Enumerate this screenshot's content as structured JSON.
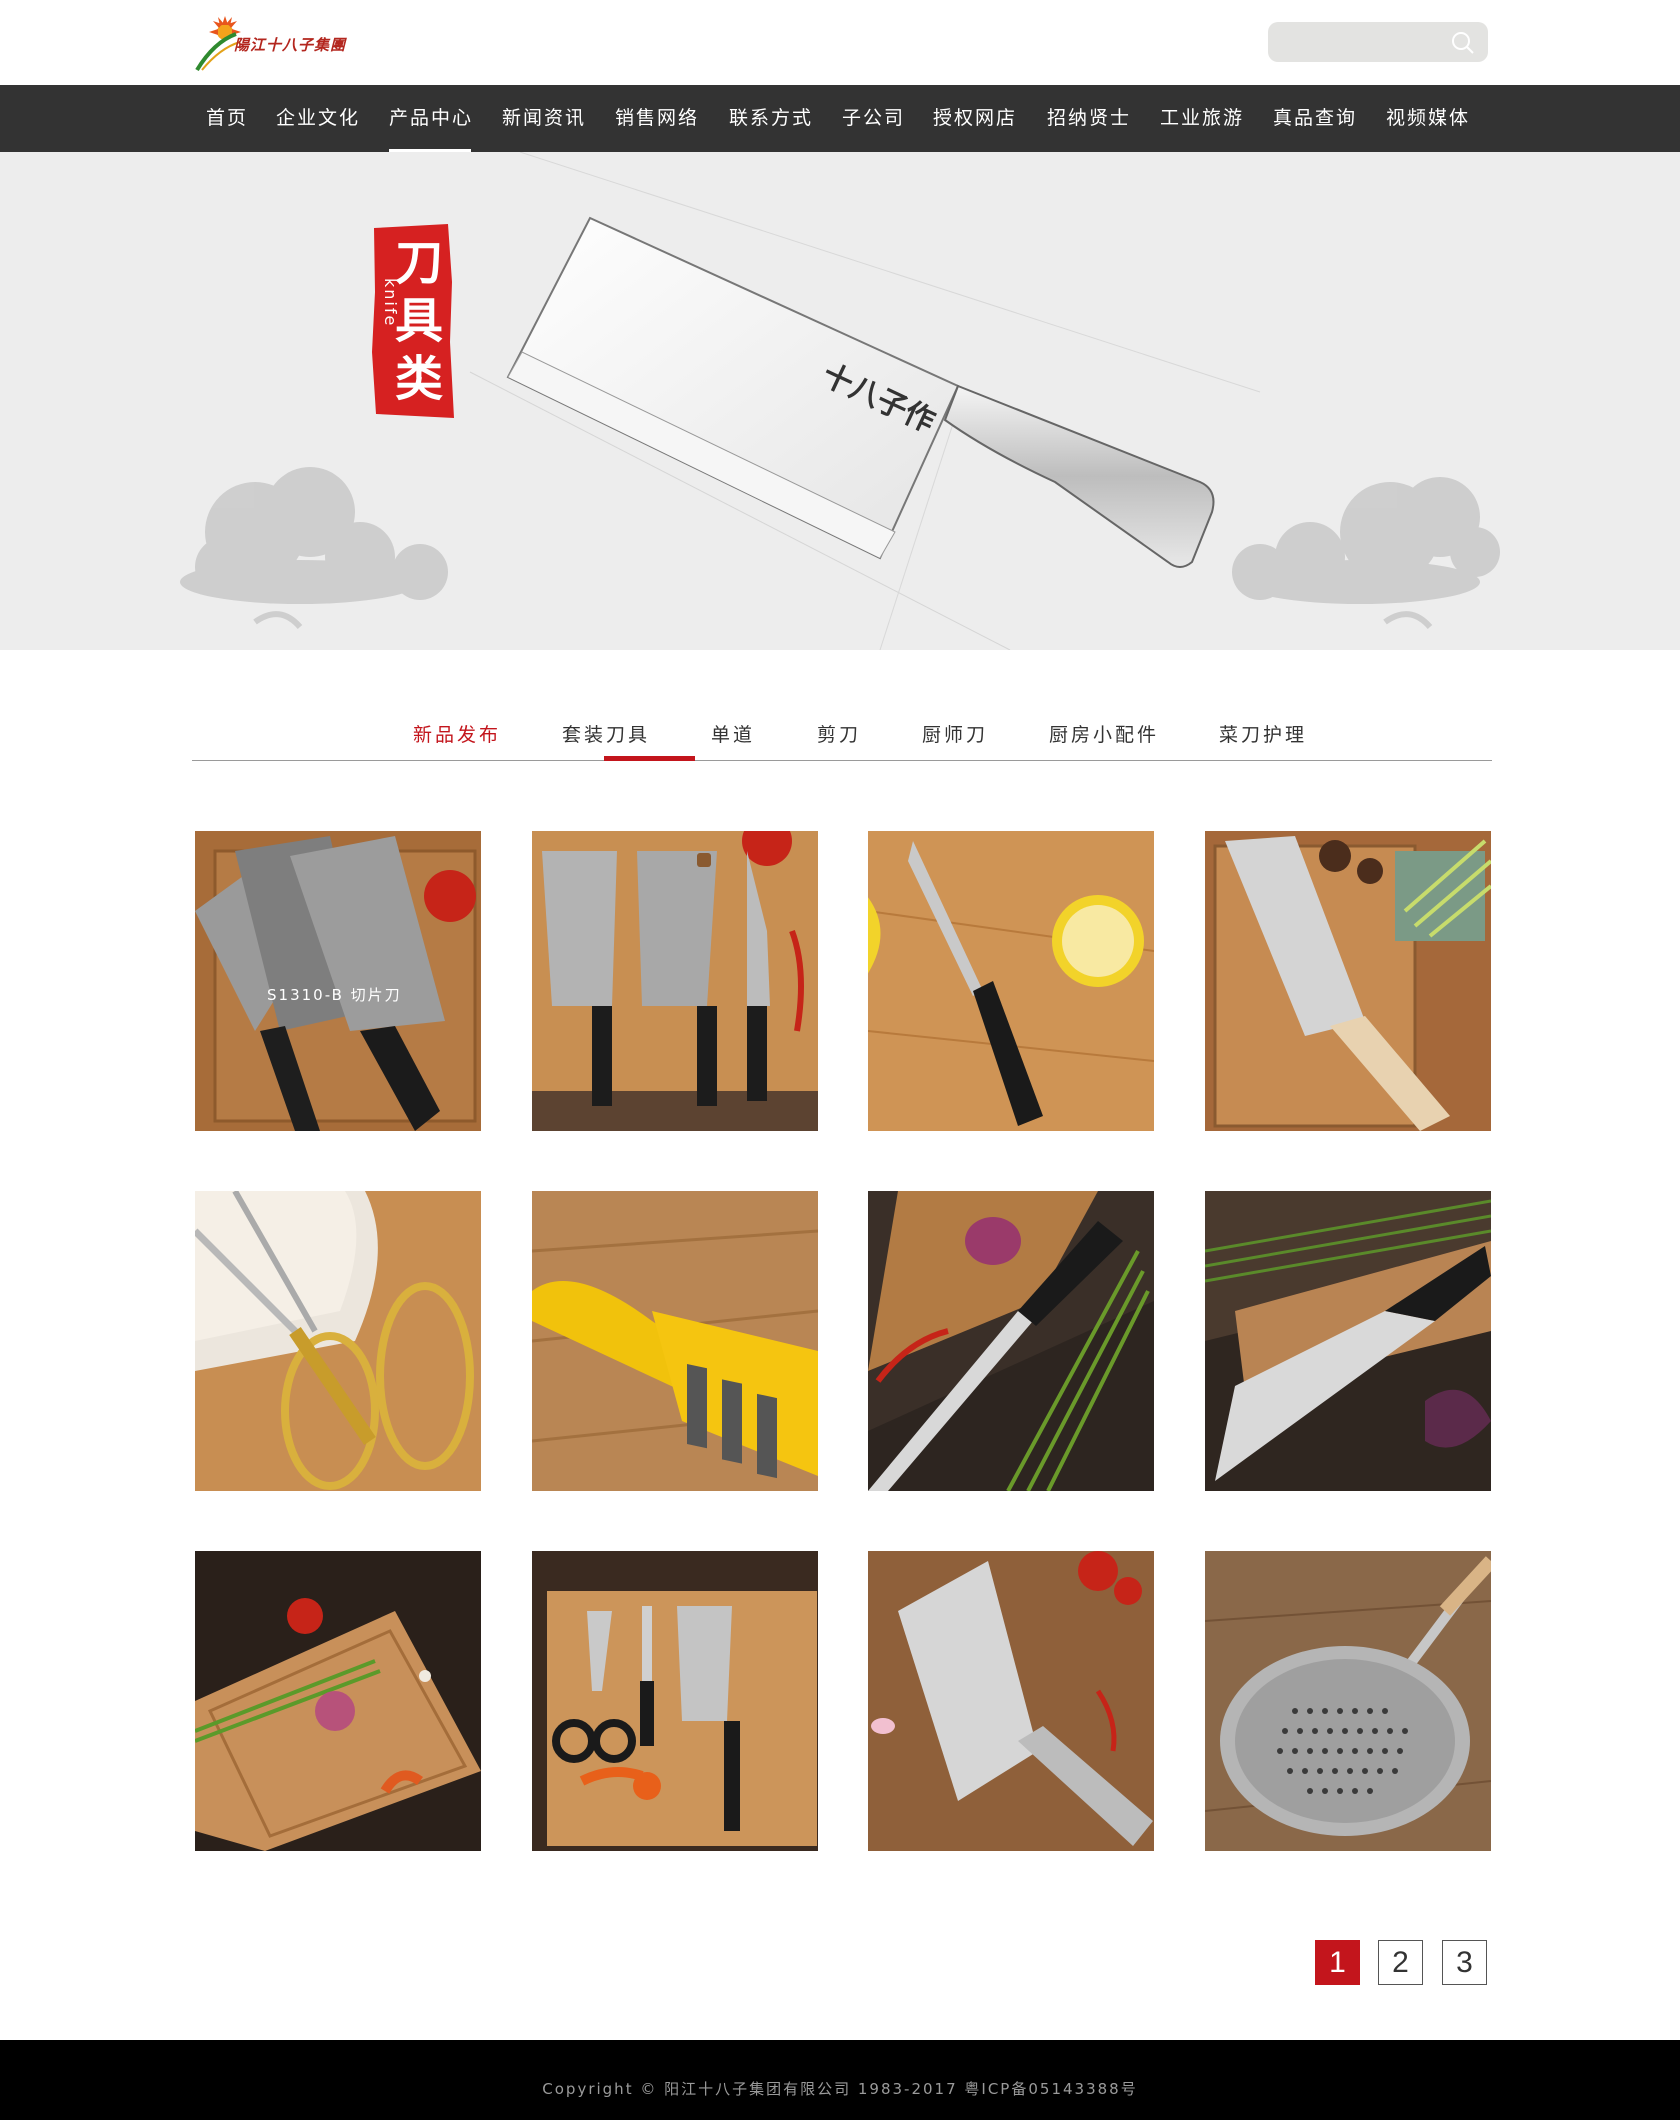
{
  "header": {
    "logo_text": "陽江十八子集團",
    "search": {
      "placeholder": "",
      "icon": "search-icon"
    }
  },
  "nav": {
    "items": [
      {
        "label": "首页"
      },
      {
        "label": "企业文化"
      },
      {
        "label": "产品中心",
        "active": true
      },
      {
        "label": "新闻资讯"
      },
      {
        "label": "销售网络"
      },
      {
        "label": "联系方式"
      },
      {
        "label": "子公司"
      },
      {
        "label": "授权网店"
      },
      {
        "label": "招纳贤士"
      },
      {
        "label": "工业旅游"
      },
      {
        "label": "真品查询"
      },
      {
        "label": "视频媒体"
      }
    ]
  },
  "banner": {
    "stamp_cn": "刀具类",
    "stamp_en": "knife",
    "blade_mark": "十八子作"
  },
  "tabs": {
    "items": [
      {
        "label": "新品发布",
        "active": true
      },
      {
        "label": "套装刀具"
      },
      {
        "label": "单道"
      },
      {
        "label": "剪刀"
      },
      {
        "label": "厨师刀"
      },
      {
        "label": "厨房小配件"
      },
      {
        "label": "菜刀护理"
      }
    ]
  },
  "products": [
    {
      "name": "product-cleaver-pair",
      "caption": "S1310-B   切片刀"
    },
    {
      "name": "product-knife-set",
      "caption": ""
    },
    {
      "name": "product-fruit-knife",
      "caption": ""
    },
    {
      "name": "product-nakiri-wood",
      "caption": ""
    },
    {
      "name": "product-gold-scissors",
      "caption": ""
    },
    {
      "name": "product-sharpener",
      "caption": ""
    },
    {
      "name": "product-chef-knife-onion",
      "caption": ""
    },
    {
      "name": "product-santoku",
      "caption": ""
    },
    {
      "name": "product-cutting-board",
      "caption": ""
    },
    {
      "name": "product-tool-set",
      "caption": ""
    },
    {
      "name": "product-steel-cleaver",
      "caption": ""
    },
    {
      "name": "product-strainer-ladle",
      "caption": ""
    }
  ],
  "pagination": {
    "pages": [
      "1",
      "2",
      "3"
    ],
    "current": "1"
  },
  "footer": {
    "text": "Copyright © 阳江十八子集团有限公司 1983-2017   粤ICP备05143388号"
  },
  "colors": {
    "accent": "#c3151c",
    "nav_bg": "#333333",
    "footer_bg": "#000000"
  }
}
